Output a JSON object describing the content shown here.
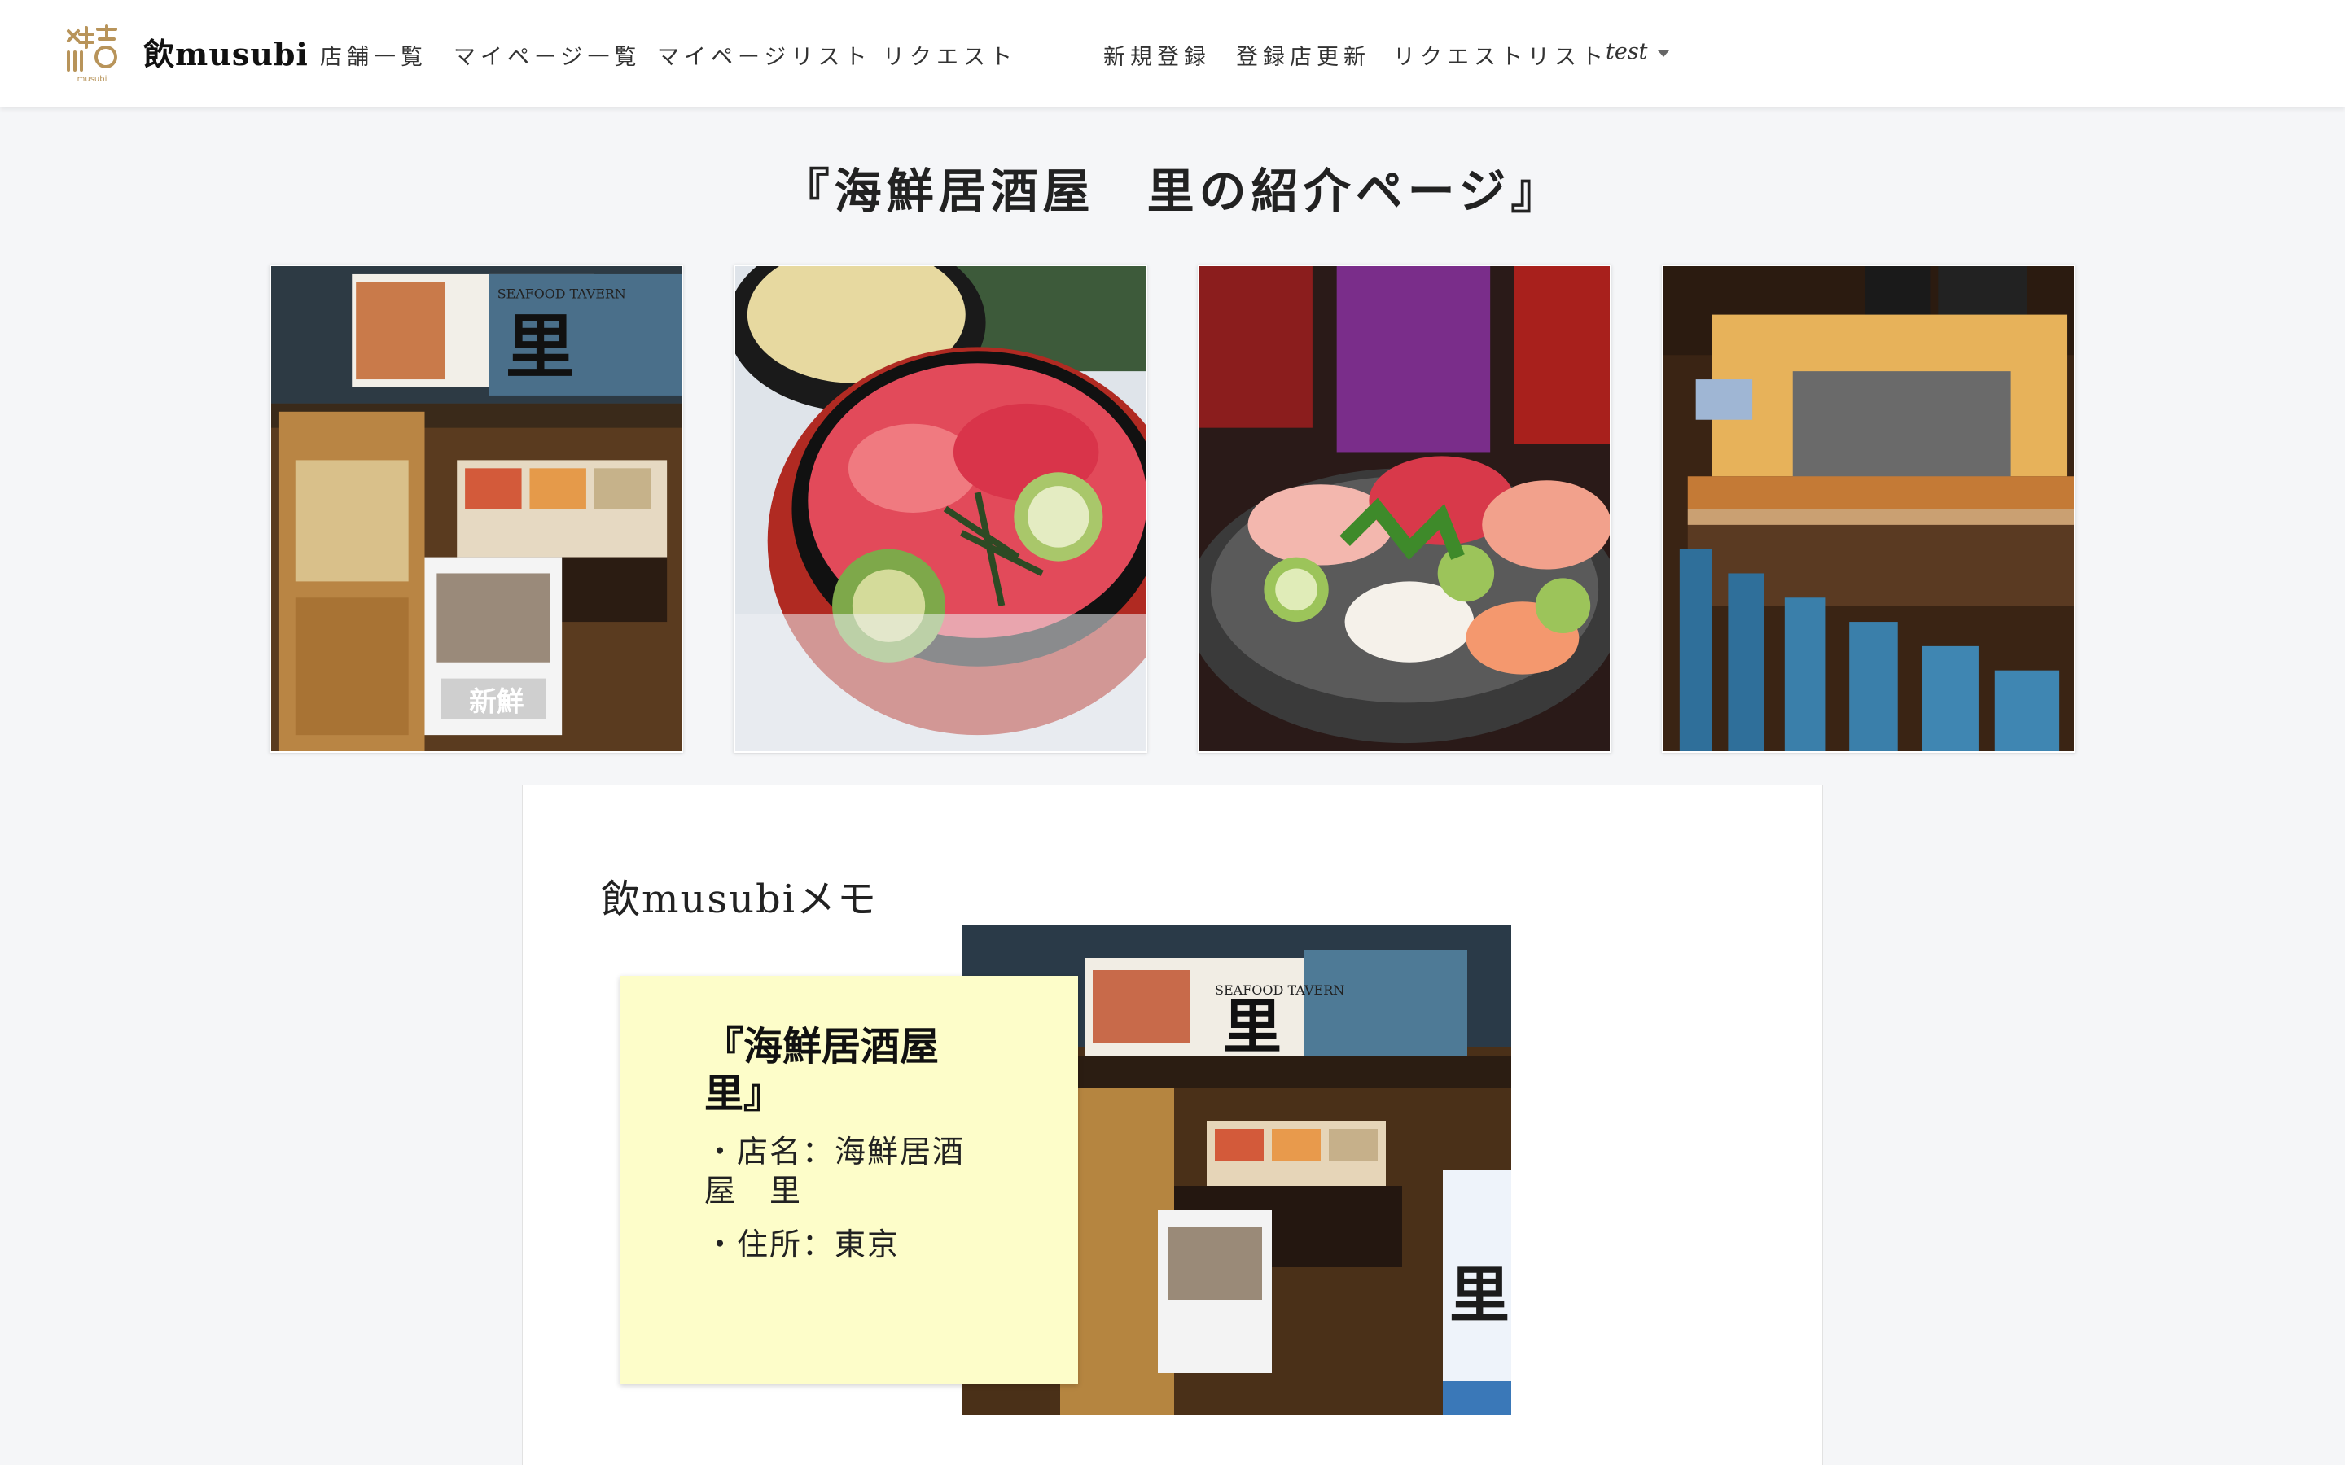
{
  "nav": {
    "brand": "飲musubi",
    "links": [
      "店舗一覧",
      "マイページ一覧",
      "マイページリスト",
      "リクエスト",
      "新規登録",
      "登録店更新",
      "リクエストリスト"
    ],
    "user": "test"
  },
  "page": {
    "title": "『海鮮居酒屋　里の紹介ページ』"
  },
  "card": {
    "title": "飲musubiメモ",
    "sticky_title": "『海鮮居酒屋　里』",
    "shop_name_line": "・店名：海鮮居酒屋　里",
    "address_line": "・住所：東京"
  },
  "photo_text": {
    "storefront_sign": "里",
    "storefront_sign_caption": "SEAFOOD TAVERN",
    "banner_sign": "新鮮"
  },
  "colors": {
    "navbar_bg": "#ffffff",
    "page_bg": "#f5f6f8",
    "sticky_bg": "#fdfdc9",
    "logo_gold": "#b8945a"
  }
}
